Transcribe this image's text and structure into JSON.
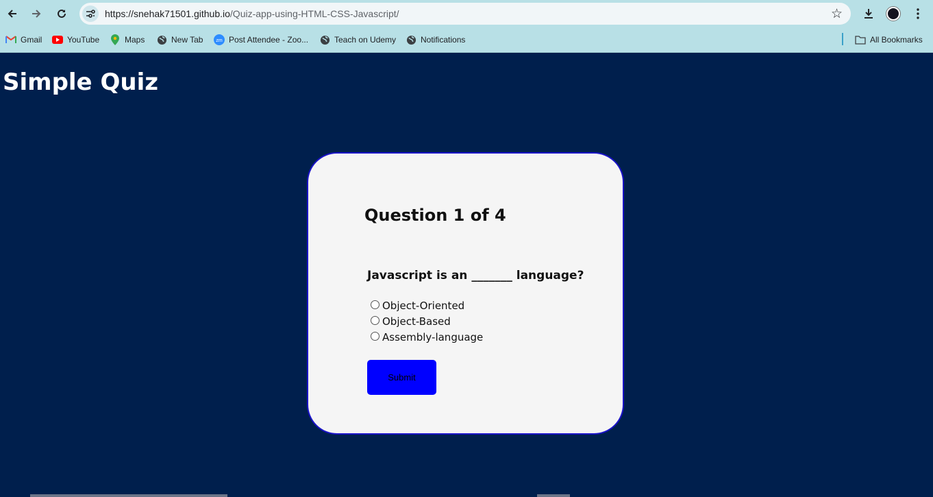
{
  "browser": {
    "url_host": "https://snehak71501.github.io",
    "url_path": "/Quiz-app-using-HTML-CSS-Javascript/",
    "bookmarks": [
      {
        "label": "Gmail",
        "icon": "gmail-icon"
      },
      {
        "label": "YouTube",
        "icon": "youtube-icon"
      },
      {
        "label": "Maps",
        "icon": "maps-icon"
      },
      {
        "label": "New Tab",
        "icon": "globe-icon"
      },
      {
        "label": "Post Attendee - Zoo...",
        "icon": "zoom-icon"
      },
      {
        "label": "Teach on Udemy",
        "icon": "globe-icon"
      },
      {
        "label": "Notifications",
        "icon": "globe-icon"
      }
    ],
    "all_bookmarks_label": "All Bookmarks"
  },
  "page": {
    "title": "Simple Quiz",
    "question_counter": "Question 1 of 4",
    "question": "Javascript is an _______ language?",
    "options": [
      "Object-Oriented",
      "Object-Based",
      "Assembly-language"
    ],
    "submit_label": "Submit"
  },
  "colors": {
    "page_bg": "#001f4d",
    "card_bg": "#f5f5f5",
    "card_border": "#1a13c8",
    "submit_bg": "#0000ff",
    "chrome_bg": "#b8e0e6"
  }
}
